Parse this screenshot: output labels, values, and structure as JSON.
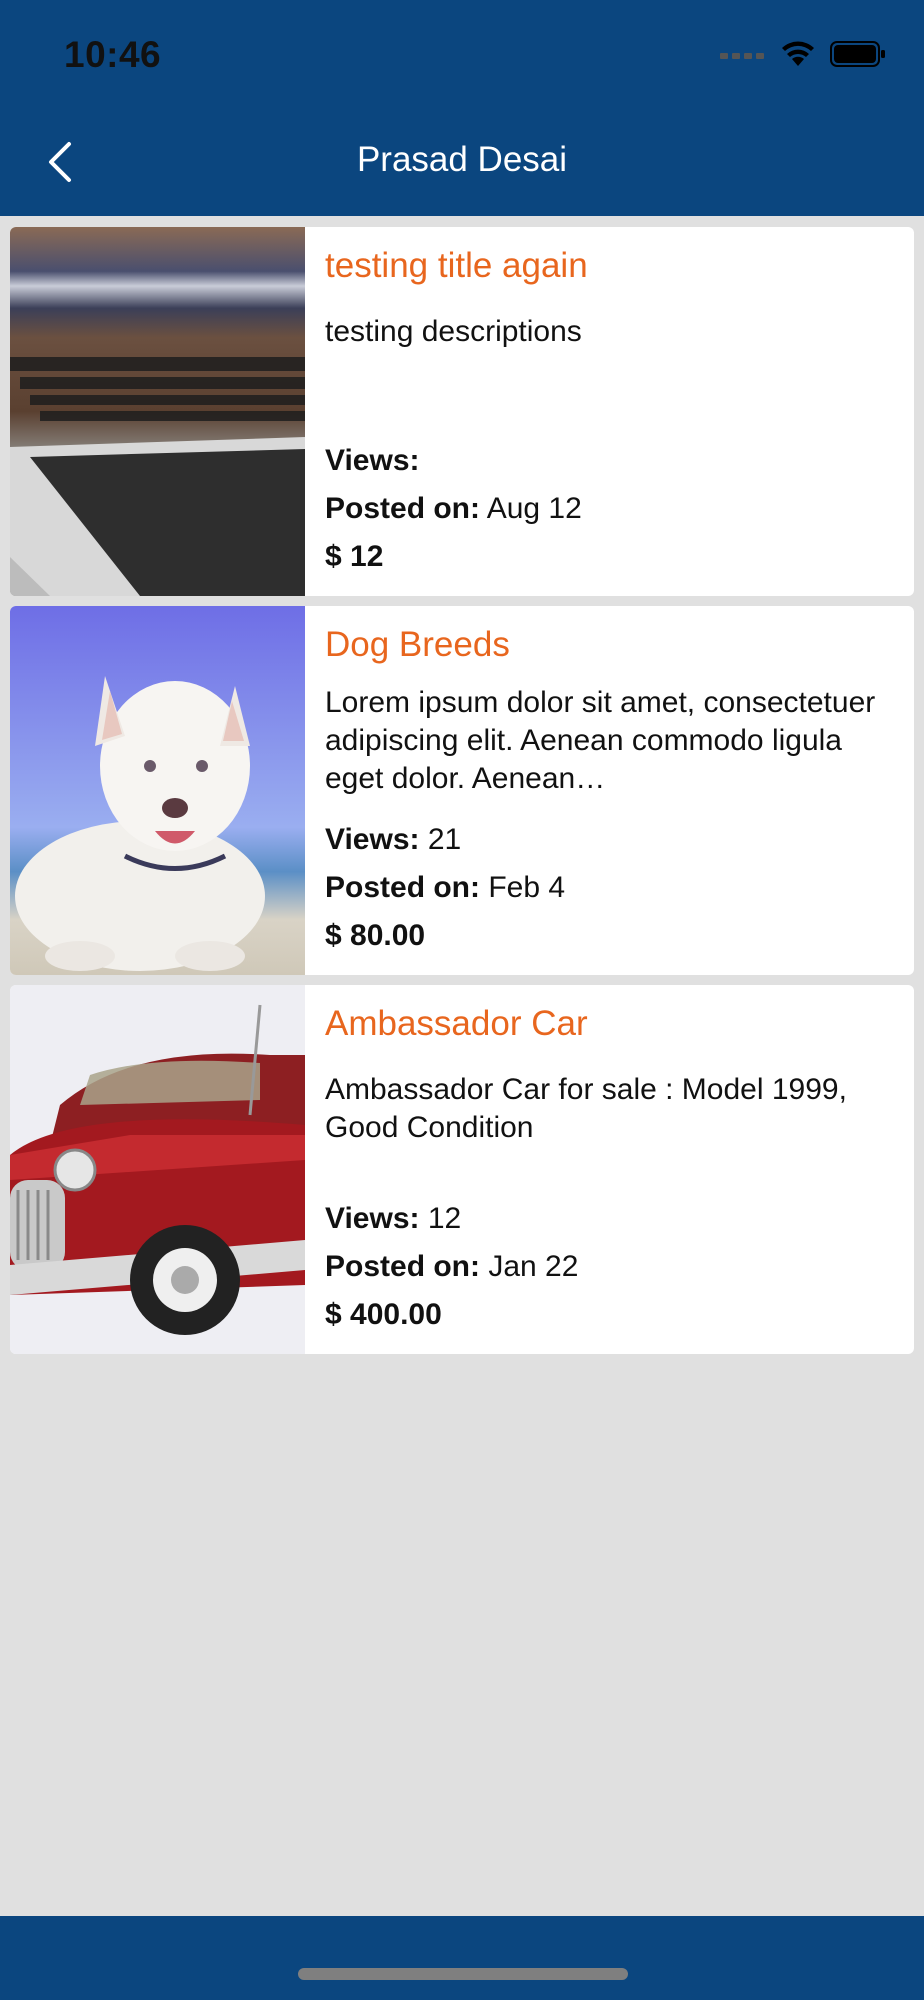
{
  "status": {
    "time": "10:46"
  },
  "nav": {
    "title": "Prasad Desai"
  },
  "labels": {
    "views": "Views:",
    "posted": "Posted on:"
  },
  "listings": [
    {
      "title": "testing title again",
      "description": "testing descriptions",
      "views": "",
      "posted": "Aug 12",
      "price": "$ 12"
    },
    {
      "title": "Dog Breeds",
      "description": "Lorem ipsum dolor sit amet, consectetuer adipiscing elit. Aenean commodo ligula eget dolor. Aenean…",
      "views": "21",
      "posted": "Feb 4",
      "price": "$ 80.00"
    },
    {
      "title": "Ambassador Car",
      "description": "Ambassador Car for sale : Model 1999, Good Condition",
      "views": "12",
      "posted": "Jan 22",
      "price": "$ 400.00"
    }
  ],
  "colors": {
    "nav": "#0b467f",
    "title_accent": "#e8661e",
    "background": "#e0e0e0"
  }
}
